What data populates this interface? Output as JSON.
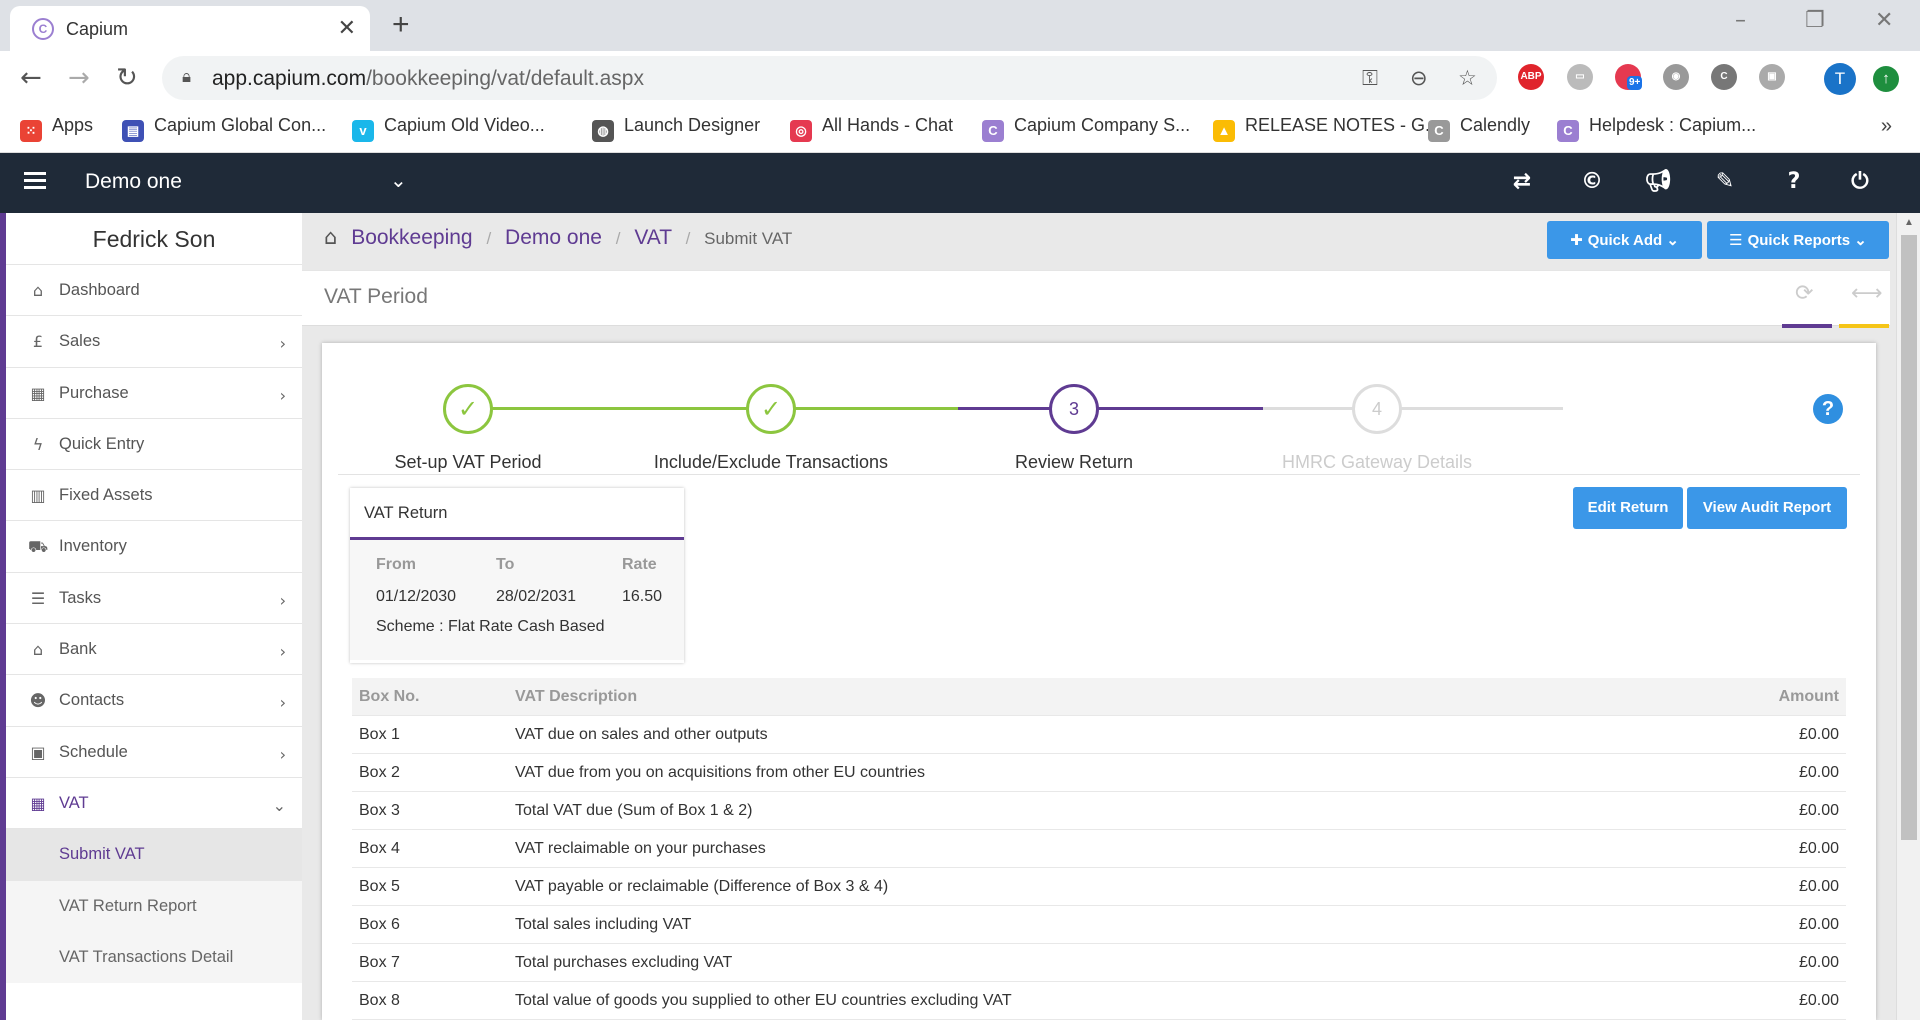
{
  "browser": {
    "tab_title": "Capium",
    "tab_favicon": "C",
    "url_host": "app.capium.com",
    "url_path": "/bookkeeping/vat/default.aspx",
    "extension_badge": "9+",
    "extension_abp": "ABP",
    "profile_initial": "T",
    "bookmarks": [
      {
        "label": "Apps",
        "icon": "apps-grid-icon",
        "color": "#ea4335",
        "glyph": "⁙"
      },
      {
        "label": "Capium Global Con...",
        "icon": "capium-doc-icon",
        "color": "#3f51b5",
        "glyph": "▤"
      },
      {
        "label": "Capium Old Video...",
        "icon": "vimeo-icon",
        "color": "#1ab7ea",
        "glyph": "v"
      },
      {
        "label": "Launch Designer",
        "icon": "globe-icon",
        "color": "#555555",
        "glyph": "◍"
      },
      {
        "label": "All Hands - Chat",
        "icon": "chat-icon",
        "color": "#e53950",
        "glyph": "◎"
      },
      {
        "label": "Capium Company S...",
        "icon": "capium-icon",
        "color": "#9b7fd1",
        "glyph": "C"
      },
      {
        "label": "RELEASE NOTES - G...",
        "icon": "google-drive-icon",
        "color": "#fbbc04",
        "glyph": "▲"
      },
      {
        "label": "Calendly",
        "icon": "calendly-icon",
        "color": "#999999",
        "glyph": "C"
      },
      {
        "label": "Helpdesk : Capium...",
        "icon": "capium-icon",
        "color": "#9b7fd1",
        "glyph": "C"
      }
    ],
    "bookmarks_more": "»"
  },
  "header": {
    "client_name": "Demo one",
    "bg_color": "#1f2a38"
  },
  "sidebar": {
    "user_name": "Fedrick Son",
    "accent": "#5f3b92",
    "items": [
      {
        "label": "Dashboard",
        "icon": "home-icon",
        "glyph": "⌂",
        "arrow": ""
      },
      {
        "label": "Sales",
        "icon": "pound-icon",
        "glyph": "£",
        "arrow": "›"
      },
      {
        "label": "Purchase",
        "icon": "qrcode-icon",
        "glyph": "▦",
        "arrow": "›"
      },
      {
        "label": "Quick Entry",
        "icon": "bolt-icon",
        "glyph": "ϟ",
        "arrow": ""
      },
      {
        "label": "Fixed Assets",
        "icon": "building-icon",
        "glyph": "▥",
        "arrow": ""
      },
      {
        "label": "Inventory",
        "icon": "truck-icon",
        "glyph": "⛟",
        "arrow": ""
      },
      {
        "label": "Tasks",
        "icon": "tasks-icon",
        "glyph": "☰",
        "arrow": "›"
      },
      {
        "label": "Bank",
        "icon": "bank-icon",
        "glyph": "⌂",
        "arrow": "›"
      },
      {
        "label": "Contacts",
        "icon": "users-icon",
        "glyph": "☻",
        "arrow": "›"
      },
      {
        "label": "Schedule",
        "icon": "calendar-icon",
        "glyph": "▣",
        "arrow": "›"
      },
      {
        "label": "VAT",
        "icon": "calculator-icon",
        "glyph": "▦",
        "arrow": "⌄"
      }
    ],
    "vat_sub": [
      "Submit VAT",
      "VAT Return Report",
      "VAT Transactions Detail"
    ]
  },
  "breadcrumb": {
    "items": [
      "Bookkeeping",
      "Demo one",
      "VAT"
    ],
    "current": "Submit VAT"
  },
  "actions": {
    "quick_add": "Quick Add",
    "quick_reports": "Quick Reports",
    "edit_return": "Edit Return",
    "view_audit_report": "View Audit Report"
  },
  "period_bar": {
    "label": "VAT Period",
    "underline_colors": [
      "#5f3b92",
      "#f5c518"
    ]
  },
  "stepper": {
    "steps": [
      {
        "number": "1",
        "label": "Set-up VAT Period",
        "state": "done"
      },
      {
        "number": "2",
        "label": "Include/Exclude Transactions",
        "state": "done"
      },
      {
        "number": "3",
        "label": "Review Return",
        "state": "current"
      },
      {
        "number": "4",
        "label": "HMRC Gateway Details",
        "state": "pending"
      }
    ],
    "done_color": "#8cc63f",
    "current_color": "#5f3b92",
    "pending_color": "#dddddd"
  },
  "vat_return": {
    "title": "VAT Return",
    "from_label": "From",
    "to_label": "To",
    "rate_label": "Rate",
    "from": "01/12/2030",
    "to": "28/02/2031",
    "rate": "16.50",
    "scheme": "Scheme : Flat Rate Cash Based"
  },
  "box_table": {
    "headers": [
      "Box No.",
      "VAT Description",
      "Amount"
    ],
    "rows": [
      [
        "Box 1",
        "VAT due on sales and other outputs",
        "£0.00"
      ],
      [
        "Box 2",
        "VAT due from you on acquisitions from other EU countries",
        "£0.00"
      ],
      [
        "Box 3",
        "Total VAT due (Sum of Box 1 & 2)",
        "£0.00"
      ],
      [
        "Box 4",
        "VAT reclaimable on your purchases",
        "£0.00"
      ],
      [
        "Box 5",
        "VAT payable or reclaimable (Difference of Box 3 & 4)",
        "£0.00"
      ],
      [
        "Box 6",
        "Total sales including VAT",
        "£0.00"
      ],
      [
        "Box 7",
        "Total purchases excluding VAT",
        "£0.00"
      ],
      [
        "Box 8",
        "Total value of goods you supplied to other EU countries excluding VAT",
        "£0.00"
      ]
    ]
  }
}
